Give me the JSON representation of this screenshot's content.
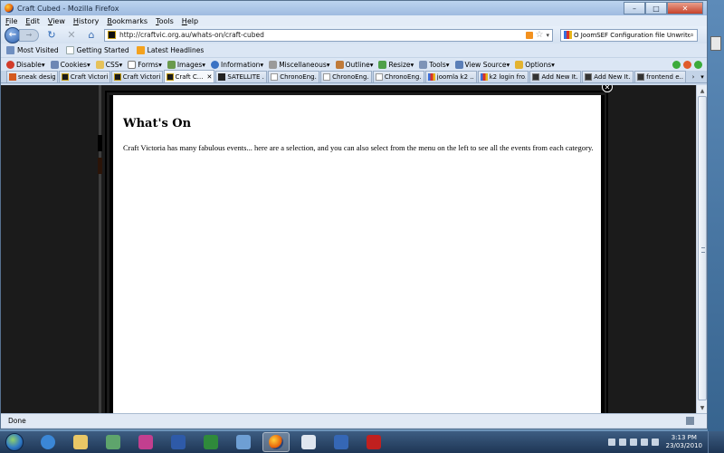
{
  "window": {
    "title": "Craft Cubed - Mozilla Firefox"
  },
  "window_controls": {
    "minimize": "–",
    "maximize": "□",
    "close": "✕"
  },
  "menu": [
    "File",
    "Edit",
    "View",
    "History",
    "Bookmarks",
    "Tools",
    "Help"
  ],
  "navigation": {
    "back": "←",
    "forward": "→",
    "reload": "↻",
    "stop": "✕",
    "home": "⌂",
    "url": "http://craftvic.org.au/whats-on/craft-cubed",
    "star": "☆",
    "dropdown": "▾",
    "search_text": "O JoomSEF Configuration file Unwriteable",
    "search_icon": "⌕"
  },
  "bookmarks": [
    "Most Visited",
    "Getting Started",
    "Latest Headlines"
  ],
  "devbar": {
    "items": [
      "Disable▾",
      "Cookies▾",
      "CSS▾",
      "Forms▾",
      "Images▾",
      "Information▾",
      "Miscellaneous▾",
      "Outline▾",
      "Resize▾",
      "Tools▾",
      "View Source▾",
      "Options▾"
    ]
  },
  "tabs": [
    {
      "label": "sneak desig..."
    },
    {
      "label": "Craft Victori..."
    },
    {
      "label": "Craft Victori..."
    },
    {
      "label": "Craft C..."
    },
    {
      "label": "SATELLITE ..."
    },
    {
      "label": "ChronoEng..."
    },
    {
      "label": "ChronoEng..."
    },
    {
      "label": "ChronoEng..."
    },
    {
      "label": "joomla k2 ..."
    },
    {
      "label": "k2 login fro..."
    },
    {
      "label": "Add New It..."
    },
    {
      "label": "Add New It..."
    },
    {
      "label": "frontend e..."
    }
  ],
  "tab_close": "✕",
  "tab_arrows": [
    "›",
    "▾"
  ],
  "page": {
    "heading": "What's On",
    "text": "Craft Victoria has many fabulous events... here are a selection, and you can also select from the menu on the left to see all the events from each category.",
    "modal_close": "✕"
  },
  "scrollbar": {
    "up": "▲",
    "down": "▼"
  },
  "status": {
    "text": "Done"
  },
  "taskbar": {
    "time": "3:13 PM",
    "date": "23/03/2010"
  },
  "colors": {
    "tab_icon_craft": "#1a1a1a",
    "tab_icon_chrono": "#ffffff",
    "tab_icon_k2": "#e8b21c",
    "accent_blue": "#2b5eaa"
  }
}
